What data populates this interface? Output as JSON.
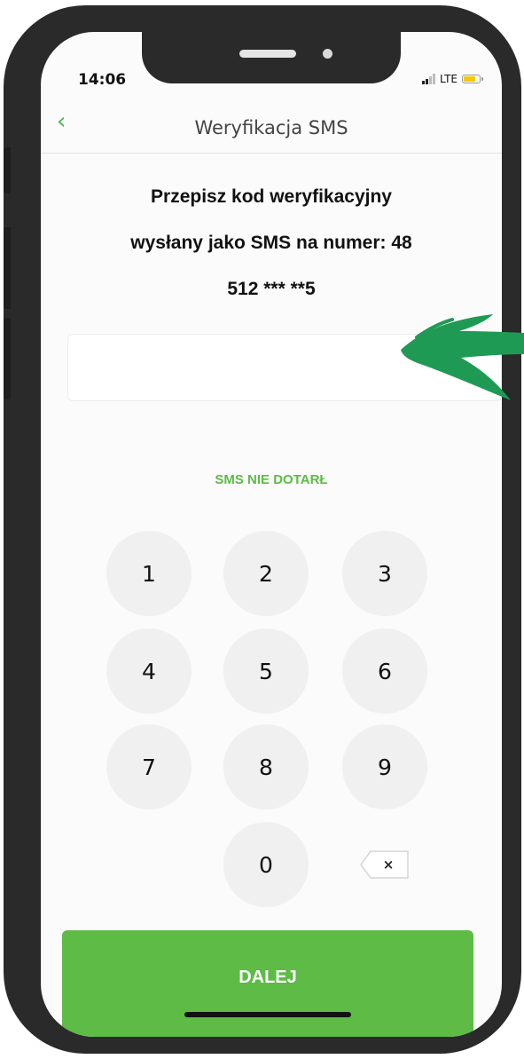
{
  "status_bar": {
    "time": "14:06",
    "network": "LTE",
    "battery_level": 0.7
  },
  "header": {
    "back_icon": "chevron-left-icon",
    "back_glyph": "‹",
    "title": "Weryfikacja SMS"
  },
  "instruction": {
    "line1": "Przepisz kod weryfikacyjny",
    "line2": "wysłany jako SMS na numer: 48",
    "line3": "512 *** **5"
  },
  "code_input": {
    "value": "",
    "placeholder": ""
  },
  "sms_link": "SMS NIE DOTARŁ",
  "keypad": {
    "keys": [
      "1",
      "2",
      "3",
      "4",
      "5",
      "6",
      "7",
      "8",
      "9",
      "0"
    ],
    "backspace_glyph": "×",
    "backspace_icon": "backspace-icon"
  },
  "next_button": "DALEJ",
  "colors": {
    "accent": "#5dbb46",
    "arrow": "#1f9a55",
    "key_background": "#f0f0f0",
    "battery": "#f4c800"
  }
}
